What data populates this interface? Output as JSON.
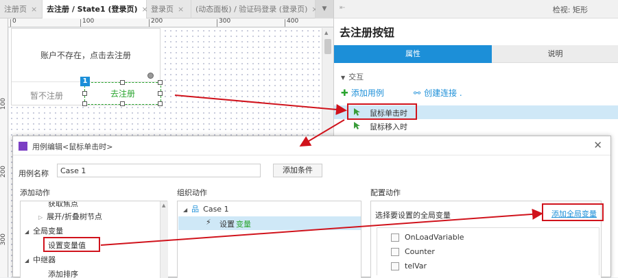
{
  "tabs": [
    {
      "label": "注册页",
      "active": false
    },
    {
      "label": "去注册 / State1 (登录页)",
      "active": true
    },
    {
      "label": "登录页",
      "active": false
    },
    {
      "label": "(动态面板) / 验证码登录 (登录页)",
      "active": false
    }
  ],
  "tab_close": "×",
  "tab_overflow": "▼",
  "ruler": {
    "h_ticks": [
      "0",
      "100",
      "200",
      "300",
      "400"
    ],
    "v_ticks": [
      "100",
      "200",
      "300"
    ]
  },
  "canvas": {
    "message": "账户不存在，点击去注册",
    "cancel_label": "暂不注册",
    "selected_label": "去注册",
    "badge": "1"
  },
  "inspector": {
    "header_title": "检视: 矩形",
    "widget_name": "去注册按钮",
    "tab_properties": "属性",
    "tab_notes": "说明",
    "section": "交互",
    "add_case": "添加用例",
    "create_link": "创建连接 .",
    "events": [
      "鼠标单击时",
      "鼠标移入时"
    ]
  },
  "dialog": {
    "title": "用例编辑<鼠标单击时>",
    "case_name_label": "用例名称",
    "case_name_value": "Case 1",
    "add_condition": "添加条件",
    "col_add_action": "添加动作",
    "col_organize": "组织动作",
    "col_configure": "配置动作",
    "add_action_items": [
      {
        "label": "获取焦点",
        "indent": 2,
        "tri": ""
      },
      {
        "label": "展开/折叠树节点",
        "indent": 2,
        "tri": "▷"
      },
      {
        "label": "全局变量",
        "indent": 1,
        "tri": "◢"
      },
      {
        "label": "设置变量值",
        "indent": 3,
        "tri": ""
      },
      {
        "label": "中继器",
        "indent": 1,
        "tri": "◢"
      },
      {
        "label": "添加排序",
        "indent": 3,
        "tri": ""
      }
    ],
    "organize": {
      "case": "Case 1",
      "action_verb": "设置",
      "action_obj": "变量"
    },
    "configure": {
      "subtitle": "选择要设置的全局变量",
      "add_global": "添加全局变量",
      "variables": [
        "OnLoadVariable",
        "Counter",
        "telVar"
      ]
    }
  },
  "colors": {
    "accent": "#1c8fd8",
    "annotation": "#d0121b",
    "green_text": "#2aa52f"
  }
}
